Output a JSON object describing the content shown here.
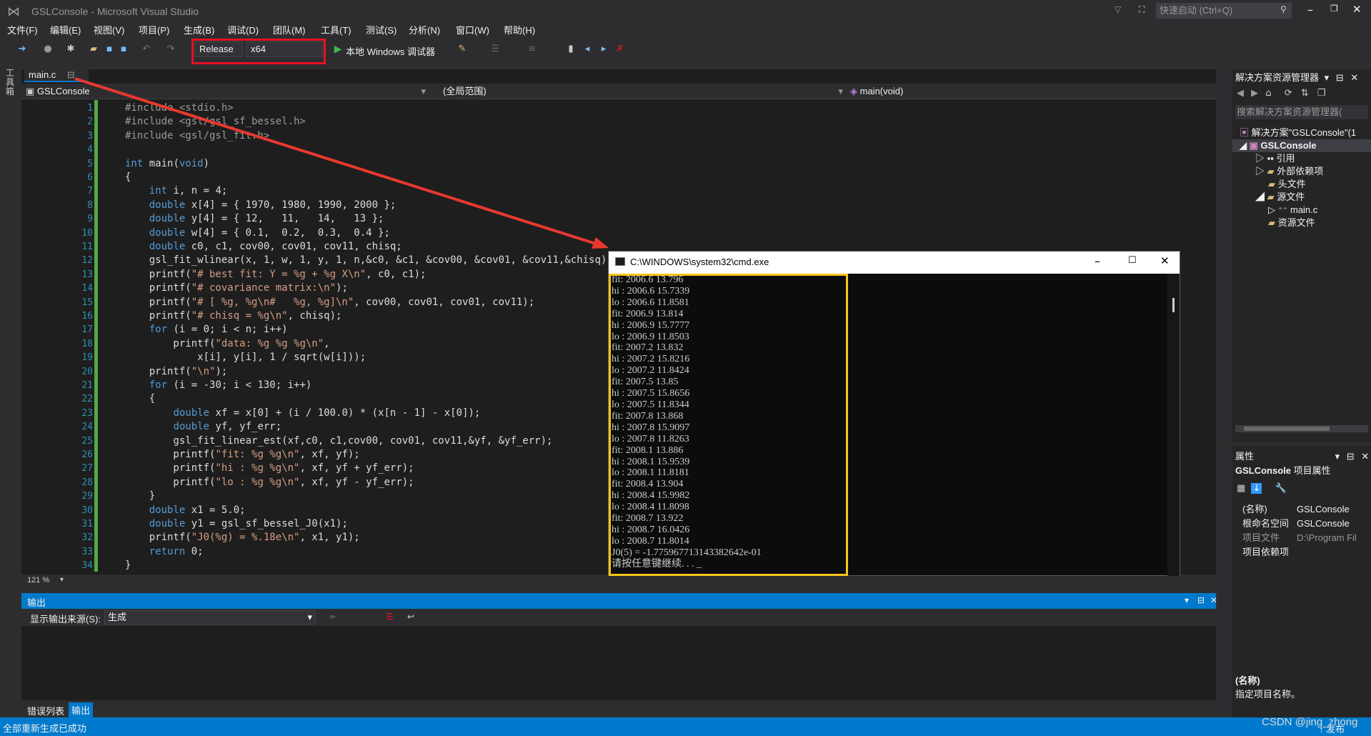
{
  "window": {
    "title": "GSLConsole - Microsoft Visual Studio",
    "quick_launch": "快速启动 (Ctrl+Q)"
  },
  "menu": [
    "文件(F)",
    "编辑(E)",
    "视图(V)",
    "项目(P)",
    "生成(B)",
    "调试(D)",
    "团队(M)",
    "工具(T)",
    "测试(S)",
    "分析(N)",
    "窗口(W)",
    "帮助(H)"
  ],
  "toolbar": {
    "config": "Release",
    "platform": "x64",
    "debugger": "本地 Windows 调试器"
  },
  "side_toolbox": "工具箱",
  "editor": {
    "tab": "main.c",
    "scope_project": "GSLConsole",
    "scope_range": "(全局范围)",
    "scope_function": "main(void)",
    "zoom": "121 %",
    "line_numbers": [
      "1",
      "2",
      "3",
      "4",
      "5",
      "6",
      "7",
      "8",
      "9",
      "10",
      "11",
      "12",
      "13",
      "14",
      "15",
      "16",
      "17",
      "18",
      "19",
      "20",
      "21",
      "22",
      "23",
      "24",
      "25",
      "26",
      "27",
      "28",
      "29",
      "30",
      "31",
      "32",
      "33",
      "34"
    ],
    "lines": [
      "#include <stdio.h>",
      "#include <gsl/gsl_sf_bessel.h>",
      "#include <gsl/gsl_fit.h>",
      "",
      "int main(void)",
      "{",
      "    int i, n = 4;",
      "    double x[4] = { 1970, 1980, 1990, 2000 };",
      "    double y[4] = { 12,   11,   14,   13 };",
      "    double w[4] = { 0.1,  0.2,  0.3,  0.4 };",
      "    double c0, c1, cov00, cov01, cov11, chisq;",
      "    gsl_fit_wlinear(x, 1, w, 1, y, 1, n,&c0, &c1, &cov00, &cov01, &cov11,&chisq);",
      "    printf(\"# best fit: Y = %g + %g X\\n\", c0, c1);",
      "    printf(\"# covariance matrix:\\n\");",
      "    printf(\"# [ %g, %g\\n#   %g, %g]\\n\", cov00, cov01, cov01, cov11);",
      "    printf(\"# chisq = %g\\n\", chisq);",
      "    for (i = 0; i < n; i++)",
      "        printf(\"data: %g %g %g\\n\",",
      "            x[i], y[i], 1 / sqrt(w[i]));",
      "    printf(\"\\n\");",
      "    for (i = -30; i < 130; i++)",
      "    {",
      "        double xf = x[0] + (i / 100.0) * (x[n - 1] - x[0]);",
      "        double yf, yf_err;",
      "        gsl_fit_linear_est(xf,c0, c1,cov00, cov01, cov11,&yf, &yf_err);",
      "        printf(\"fit: %g %g\\n\", xf, yf);",
      "        printf(\"hi : %g %g\\n\", xf, yf + yf_err);",
      "        printf(\"lo : %g %g\\n\", xf, yf - yf_err);",
      "    }",
      "    double x1 = 5.0;",
      "    double y1 = gsl_sf_bessel_J0(x1);",
      "    printf(\"J0(%g) = %.18e\\n\", x1, y1);",
      "    return 0;",
      "}"
    ]
  },
  "cmd": {
    "title": "C:\\WINDOWS\\system32\\cmd.exe",
    "lines": [
      "fit: 2006.6 13.796",
      "hi : 2006.6 15.7339",
      "lo : 2006.6 11.8581",
      "fit: 2006.9 13.814",
      "hi : 2006.9 15.7777",
      "lo : 2006.9 11.8503",
      "fit: 2007.2 13.832",
      "hi : 2007.2 15.8216",
      "lo : 2007.2 11.8424",
      "fit: 2007.5 13.85",
      "hi : 2007.5 15.8656",
      "lo : 2007.5 11.8344",
      "fit: 2007.8 13.868",
      "hi : 2007.8 15.9097",
      "lo : 2007.8 11.8263",
      "fit: 2008.1 13.886",
      "hi : 2008.1 15.9539",
      "lo : 2008.1 11.8181",
      "fit: 2008.4 13.904",
      "hi : 2008.4 15.9982",
      "lo : 2008.4 11.8098",
      "fit: 2008.7 13.922",
      "hi : 2008.7 16.0426",
      "lo : 2008.7 11.8014",
      "J0(5) = -1.775967713143382642e-01",
      "请按任意键继续. . . _"
    ]
  },
  "solution_explorer": {
    "title": "解决方案资源管理器",
    "search": "搜索解决方案资源管理器(",
    "items": [
      "解决方案\"GSLConsole\"(1",
      "GSLConsole",
      "引用",
      "外部依赖项",
      "头文件",
      "源文件",
      "main.c",
      "资源文件"
    ]
  },
  "properties": {
    "title": "属性",
    "object": "GSLConsole",
    "object_type": "项目属性",
    "rows": [
      {
        "key": "(名称)",
        "value": "GSLConsole"
      },
      {
        "key": "根命名空间",
        "value": "GSLConsole"
      },
      {
        "key": "项目文件",
        "value": "D:\\Program Fil"
      },
      {
        "key": "项目依赖项",
        "value": ""
      }
    ],
    "desc_title": "(名称)",
    "desc_text": "指定项目名称。"
  },
  "output": {
    "title": "输出",
    "source_label": "显示输出来源(S):",
    "source_value": "生成"
  },
  "bottom_tabs": [
    "错误列表",
    "输出"
  ],
  "status": {
    "text": "全部重新生成已成功",
    "publish": "↑ 发布"
  },
  "watermark": "CSDN @jing_zhong",
  "colors": {
    "accent": "#007acc",
    "highlight_red": "#e81123",
    "cmd_border": "#f5c518"
  }
}
